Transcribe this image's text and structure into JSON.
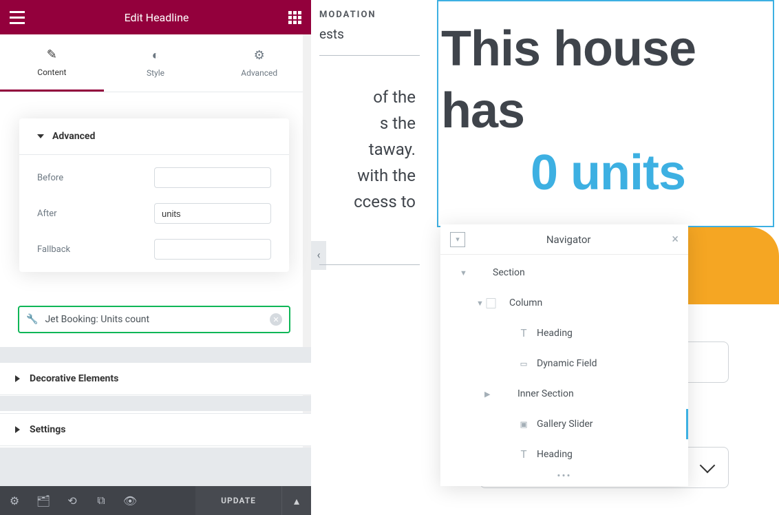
{
  "header": {
    "title": "Edit Headline"
  },
  "tabs": {
    "content": "Content",
    "style": "Style",
    "advanced": "Advanced"
  },
  "popover": {
    "title": "Advanced",
    "before_label": "Before",
    "before_value": "",
    "after_label": "After",
    "after_value": "units",
    "fallback_label": "Fallback",
    "fallback_value": ""
  },
  "dynamic_tag": {
    "text": "Jet Booking: Units count"
  },
  "sections": {
    "decorative": "Decorative Elements",
    "settings": "Settings"
  },
  "footer": {
    "update": "UPDATE"
  },
  "canvas": {
    "frag1": "MODATION",
    "frag2": "ests",
    "body_lines": [
      "of the",
      "s the",
      "taway.",
      "with the",
      "ccess to"
    ],
    "heading_part1": "This house has",
    "heading_part2": "0 units"
  },
  "navigator": {
    "title": "Navigator",
    "items": [
      {
        "label": "Section",
        "indent": 18,
        "caret": "down",
        "icon": ""
      },
      {
        "label": "Column",
        "indent": 42,
        "caret": "down",
        "icon": "⃞"
      },
      {
        "label": "Heading",
        "indent": 82,
        "caret": "",
        "icon": "T"
      },
      {
        "label": "Dynamic Field",
        "indent": 82,
        "caret": "",
        "icon": "▭"
      },
      {
        "label": "Inner Section",
        "indent": 54,
        "caret": "right",
        "icon": ""
      },
      {
        "label": "Gallery Slider",
        "indent": 82,
        "caret": "",
        "icon": "▣",
        "active": true
      },
      {
        "label": "Heading",
        "indent": 82,
        "caret": "",
        "icon": "T"
      }
    ]
  }
}
